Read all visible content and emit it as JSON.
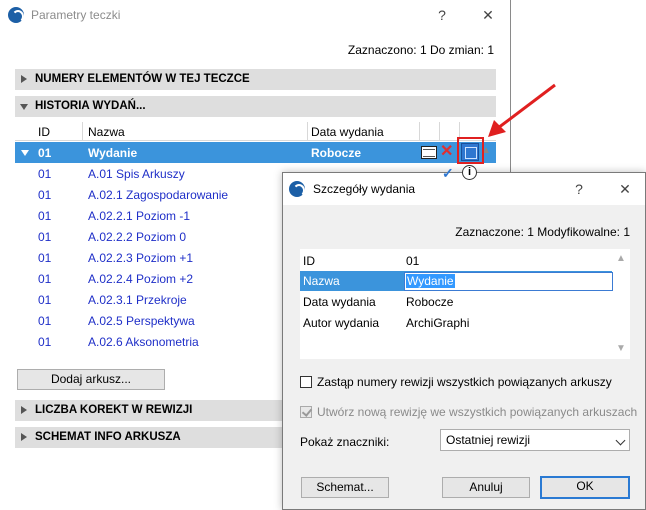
{
  "main": {
    "title": "Parametry teczki",
    "help": "?",
    "close": "✕",
    "status": "Zaznaczono: 1 Do zmian: 1",
    "sections": {
      "elements": "NUMERY ELEMENTÓW W TEJ TECZCE",
      "history": "HISTORIA WYDAŃ...",
      "corrections": "LICZBA KOREKT W REWIZJI",
      "schema": "SCHEMAT INFO ARKUSZA"
    },
    "table": {
      "headers": [
        "ID",
        "Nazwa",
        "Data wydania"
      ],
      "selected_row": {
        "id": "01",
        "name": "Wydanie",
        "date": "Robocze"
      },
      "rows": [
        {
          "id": "01",
          "name": "A.01 Spis Arkuszy"
        },
        {
          "id": "01",
          "name": "A.02.1 Zagospodarowanie"
        },
        {
          "id": "01",
          "name": "A.02.2.1 Poziom -1"
        },
        {
          "id": "01",
          "name": "A.02.2.2 Poziom 0"
        },
        {
          "id": "01",
          "name": "A.02.2.3 Poziom +1"
        },
        {
          "id": "01",
          "name": "A.02.2.4 Poziom +2"
        },
        {
          "id": "01",
          "name": "A.02.3.1 Przekroje"
        },
        {
          "id": "01",
          "name": "A.02.5 Perspektywa"
        },
        {
          "id": "01",
          "name": "A.02.6 Aksonometria"
        }
      ]
    },
    "add_sheet_button": "Dodaj arkusz..."
  },
  "details": {
    "title": "Szczegóły wydania",
    "help": "?",
    "close": "✕",
    "status": "Zaznaczone: 1 Modyfikowalne: 1",
    "props": [
      {
        "key": "ID",
        "value": "01"
      },
      {
        "key": "Nazwa",
        "value": "Wydanie"
      },
      {
        "key": "Data wydania",
        "value": "Robocze"
      },
      {
        "key": "Autor wydania",
        "value": "ArchiGraphi"
      }
    ],
    "checkbox_replace": {
      "label": "Zastąp numery rewizji wszystkich powiązanych arkuszy",
      "checked": false
    },
    "checkbox_new_revision": {
      "label": "Utwórz nową rewizję we wszystkich powiązanych arkuszach",
      "checked": true,
      "disabled": true
    },
    "show_markers_label": "Pokaż znaczniki:",
    "show_markers_value": "Ostatniej rewizji",
    "buttons": {
      "schema": "Schemat...",
      "cancel": "Anuluj",
      "ok": "OK"
    }
  },
  "icons": {
    "app": "archicad-icon",
    "publish": "book-icon",
    "delete": "delete-x-icon",
    "edit": "edit-details-icon",
    "confirm": "checkmark-icon",
    "info": "info-icon"
  },
  "colors": {
    "selection": "#3b94dc",
    "link_blue": "#1f2fc8",
    "highlight_red": "#e02020",
    "section_bar": "#dedede"
  }
}
